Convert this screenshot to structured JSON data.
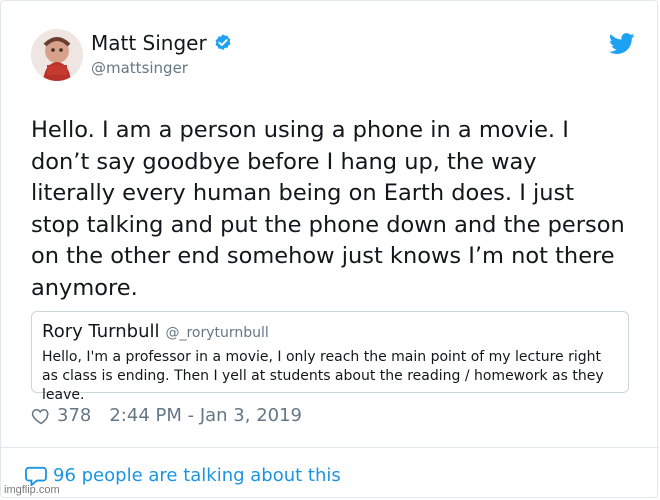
{
  "author": {
    "name": "Matt Singer",
    "handle": "@mattsinger",
    "verified": true
  },
  "tweet": {
    "text": "Hello. I am a person using a phone in a movie. I\ndon’t say goodbye before I hang up, the way\nliterally every human being on Earth does. I just\nstop talking and put the phone down and the person\non the other end somehow just knows I’m not there\nanymore."
  },
  "quote": {
    "name": "Rory Turnbull",
    "handle": "@_roryturnbull",
    "text": "Hello, I'm a professor in a movie, I only reach the main point of my lecture right as class is ending. Then I yell at students about the reading / homework as they leave."
  },
  "meta": {
    "likes": "378",
    "timestamp": "2:44 PM - Jan 3, 2019"
  },
  "footer": {
    "talking": "96 people are talking about this"
  },
  "watermark": "imgflip.com",
  "colors": {
    "twitter_blue": "#1da1f2",
    "link_blue": "#1b95e0",
    "muted_gray": "#657786",
    "border": "#e1e8ed"
  },
  "icons": [
    "verified-badge-icon",
    "twitter-bird-icon",
    "heart-icon",
    "speech-bubble-icon"
  ]
}
